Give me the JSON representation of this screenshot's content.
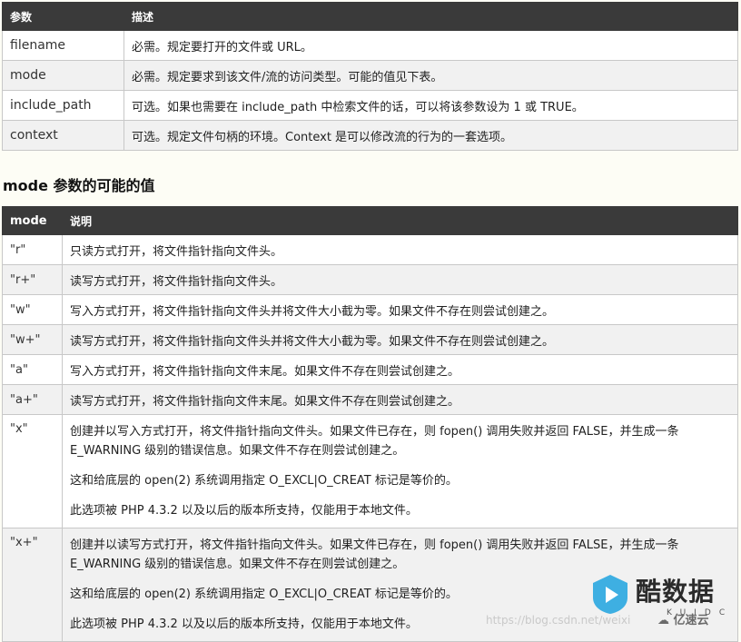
{
  "params_table": {
    "headers": [
      "参数",
      "描述"
    ],
    "rows": [
      {
        "name": "filename",
        "desc": "必需。规定要打开的文件或 URL。"
      },
      {
        "name": "mode",
        "desc": "必需。规定要求到该文件/流的访问类型。可能的值见下表。"
      },
      {
        "name": "include_path",
        "desc": "可选。如果也需要在 include_path 中检索文件的话，可以将该参数设为 1 或 TRUE。"
      },
      {
        "name": "context",
        "desc": "可选。规定文件句柄的环境。Context 是可以修改流的行为的一套选项。"
      }
    ]
  },
  "section_title": "mode 参数的可能的值",
  "modes_table": {
    "headers": [
      "mode",
      "说明"
    ],
    "rows": [
      {
        "mode": "\"r\"",
        "desc": "只读方式打开，将文件指针指向文件头。"
      },
      {
        "mode": "\"r+\"",
        "desc": "读写方式打开，将文件指针指向文件头。"
      },
      {
        "mode": "\"w\"",
        "desc": "写入方式打开，将文件指针指向文件头并将文件大小截为零。如果文件不存在则尝试创建之。"
      },
      {
        "mode": "\"w+\"",
        "desc": "读写方式打开，将文件指针指向文件头并将文件大小截为零。如果文件不存在则尝试创建之。"
      },
      {
        "mode": "\"a\"",
        "desc": "写入方式打开，将文件指针指向文件末尾。如果文件不存在则尝试创建之。"
      },
      {
        "mode": "\"a+\"",
        "desc": "读写方式打开，将文件指针指向文件末尾。如果文件不存在则尝试创建之。"
      },
      {
        "mode": "\"x\"",
        "paras": [
          "创建并以写入方式打开，将文件指针指向文件头。如果文件已存在，则 fopen() 调用失败并返回 FALSE，并生成一条 E_WARNING 级别的错误信息。如果文件不存在则尝试创建之。",
          "这和给底层的 open(2) 系统调用指定 O_EXCL|O_CREAT 标记是等价的。",
          "此选项被 PHP 4.3.2 以及以后的版本所支持，仅能用于本地文件。"
        ]
      },
      {
        "mode": "\"x+\"",
        "paras": [
          "创建并以读写方式打开，将文件指针指向文件头。如果文件已存在，则 fopen() 调用失败并返回 FALSE，并生成一条 E_WARNING 级别的错误信息。如果文件不存在则尝试创建之。",
          "这和给底层的 open(2) 系统调用指定 O_EXCL|O_CREAT 标记是等价的。",
          "此选项被 PHP 4.3.2 以及以后的版本所支持，仅能用于本地文件。"
        ]
      }
    ]
  },
  "watermark": "https://blog.csdn.net/weixi",
  "logo": {
    "text": "酷数据",
    "sub": "KUIDC",
    "icon": "play-shield-icon",
    "brand_color": "#2aa7e0"
  },
  "logo2": {
    "text": "亿速云",
    "icon": "cloud-icon"
  }
}
